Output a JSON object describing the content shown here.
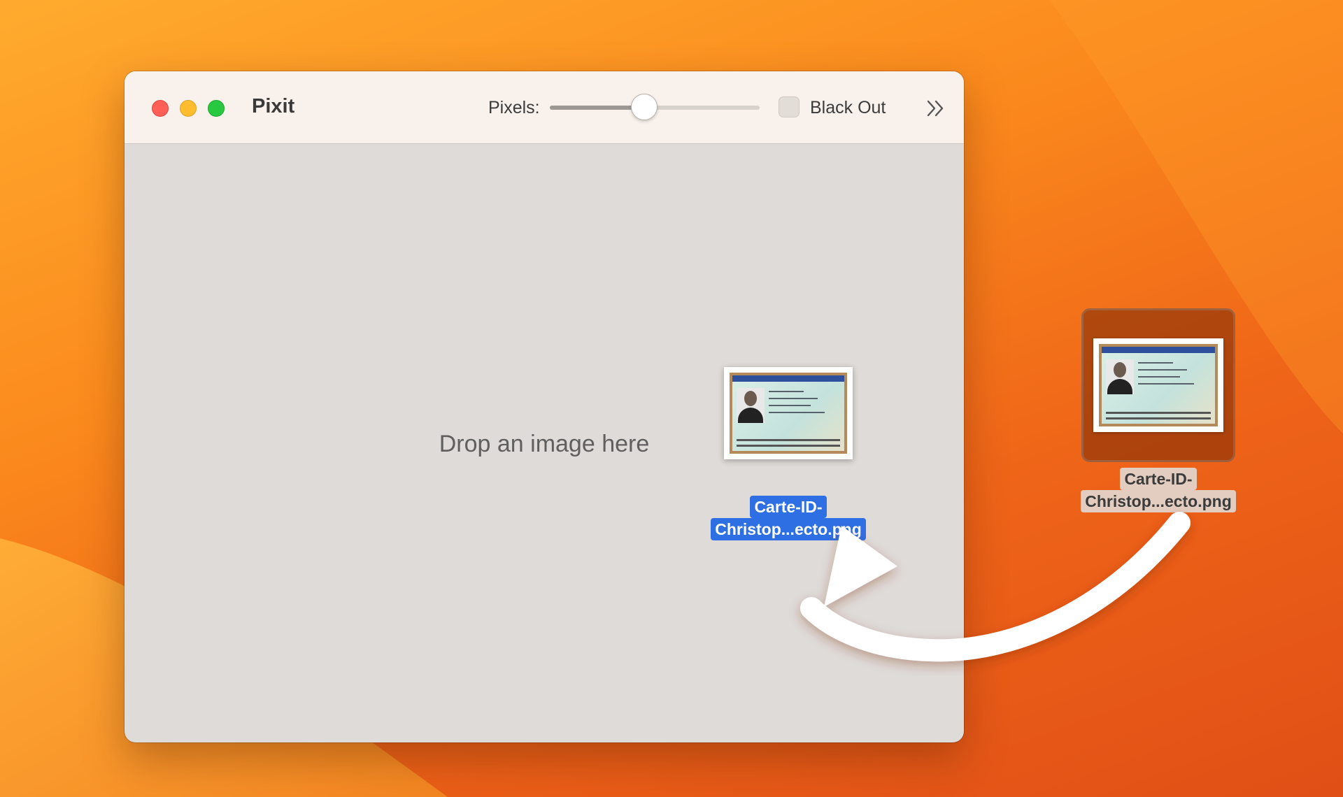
{
  "app": {
    "title": "Pixit"
  },
  "toolbar": {
    "pixels_label": "Pixels:",
    "pixels_slider_value": 0.45,
    "blackout_label": "Black Out",
    "blackout_checked": false
  },
  "content": {
    "drop_prompt": "Drop an image here"
  },
  "drag": {
    "filename_line1": "Carte-ID-",
    "filename_line2": "Christop...ecto.png"
  },
  "desktop_file": {
    "filename_line1": "Carte-ID-",
    "filename_line2": "Christop...ecto.png"
  },
  "colors": {
    "close": "#fe5f57",
    "minimize": "#febc2e",
    "zoom": "#28c840",
    "selection": "#2f6fe4"
  },
  "icons": {
    "overflow": "chevron-double-right-icon",
    "arrow": "curved-arrow-icon"
  }
}
